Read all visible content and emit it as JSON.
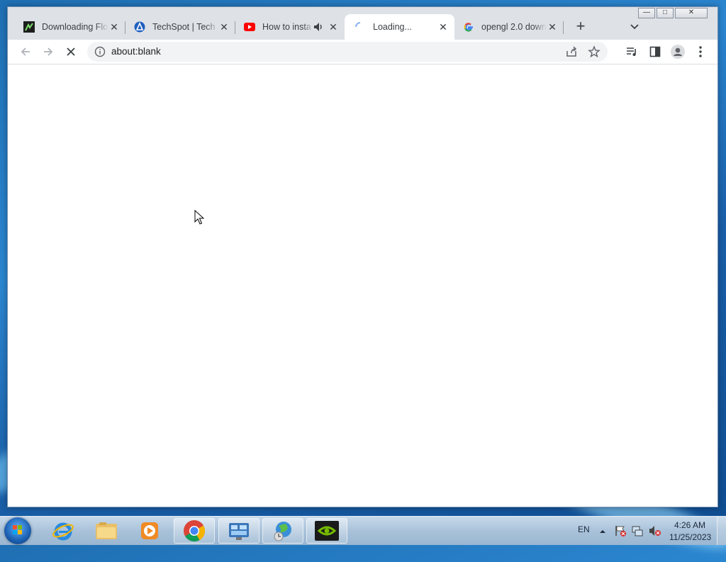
{
  "browser": {
    "tabs": [
      {
        "title": "Downloading Flo",
        "icon": "flo-app-icon",
        "active": false
      },
      {
        "title": "TechSpot | Tech E",
        "icon": "techspot-icon",
        "active": false
      },
      {
        "title": "How to insta",
        "icon": "youtube-icon",
        "active": false,
        "audio": true
      },
      {
        "title": "Loading...",
        "icon": "loading-spinner-icon",
        "active": true
      },
      {
        "title": "opengl 2.0 down",
        "icon": "google-icon",
        "active": false
      }
    ],
    "new_tab_label": "+",
    "address": "about:blank",
    "window_controls": {
      "minimize": "—",
      "maximize": "□",
      "close": "✕"
    }
  },
  "taskbar": {
    "apps": [
      {
        "name": "Internet Explorer",
        "icon": "internet-explorer-icon",
        "open": false
      },
      {
        "name": "Windows Explorer",
        "icon": "folder-icon",
        "open": false
      },
      {
        "name": "Media Player",
        "icon": "media-player-icon",
        "open": false
      },
      {
        "name": "Google Chrome",
        "icon": "chrome-icon",
        "open": true
      },
      {
        "name": "Control Panel",
        "icon": "control-panel-icon",
        "open": true
      },
      {
        "name": "Network",
        "icon": "globe-icon",
        "open": true
      },
      {
        "name": "NVIDIA",
        "icon": "nvidia-icon",
        "open": true
      }
    ],
    "language": "EN",
    "time": "4:26 AM",
    "date": "11/25/2023"
  },
  "colors": {
    "tab_strip": "#dee1e6",
    "youtube_red": "#ff0000",
    "google_blue": "#4285f4",
    "nvidia_green": "#76b900"
  }
}
